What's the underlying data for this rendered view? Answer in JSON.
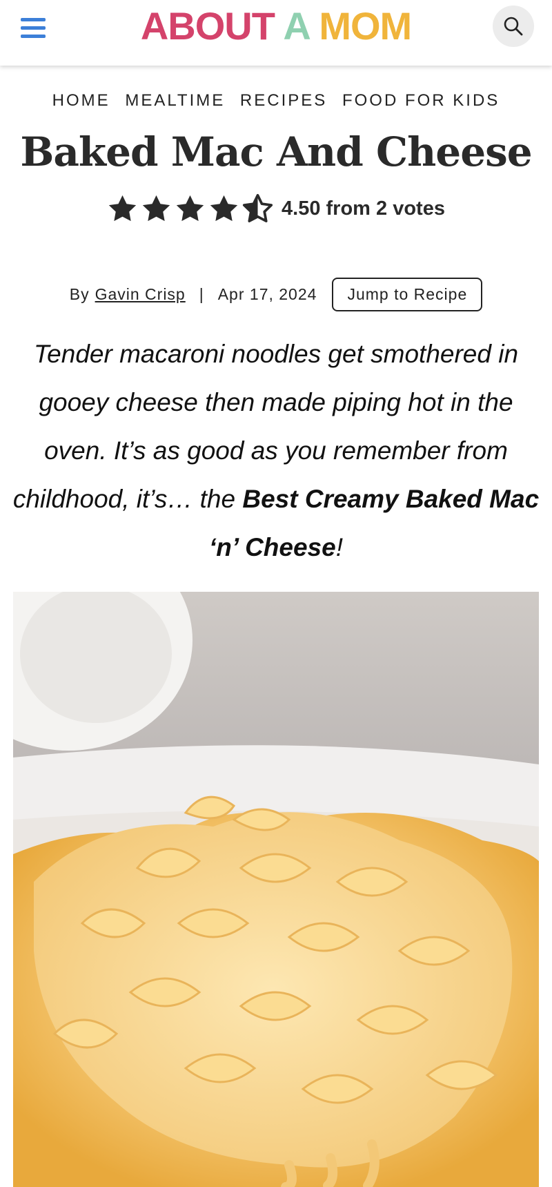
{
  "header": {
    "logo": {
      "word1": "ABOUT",
      "word2": "A",
      "word3": "MOM",
      "colors": [
        "#d4436b",
        "#8fd0b0",
        "#f0b43b"
      ]
    },
    "menu_icon": "hamburger-menu-icon",
    "search_icon": "search-icon",
    "menu_color": "#3c7fd8"
  },
  "breadcrumb": [
    "HOME",
    "MEALTIME",
    "RECIPES",
    "FOOD FOR KIDS"
  ],
  "article": {
    "title": "Baked Mac And Cheese",
    "rating": {
      "value": 4.5,
      "max": 5,
      "text": "4.50 from 2 votes"
    },
    "byline": {
      "prefix": "By",
      "author": "Gavin Crisp",
      "separator": "|",
      "date": "Apr 17, 2024"
    },
    "jump_button": "Jump to Recipe",
    "intro_text": "Tender macaroni noodles get smothered in gooey cheese then made piping hot in the oven. It’s as good as you remember from childhood, it’s… the",
    "intro_bold": "Best Creamy Baked Mac ‘n’ Cheese",
    "intro_end": "!"
  }
}
